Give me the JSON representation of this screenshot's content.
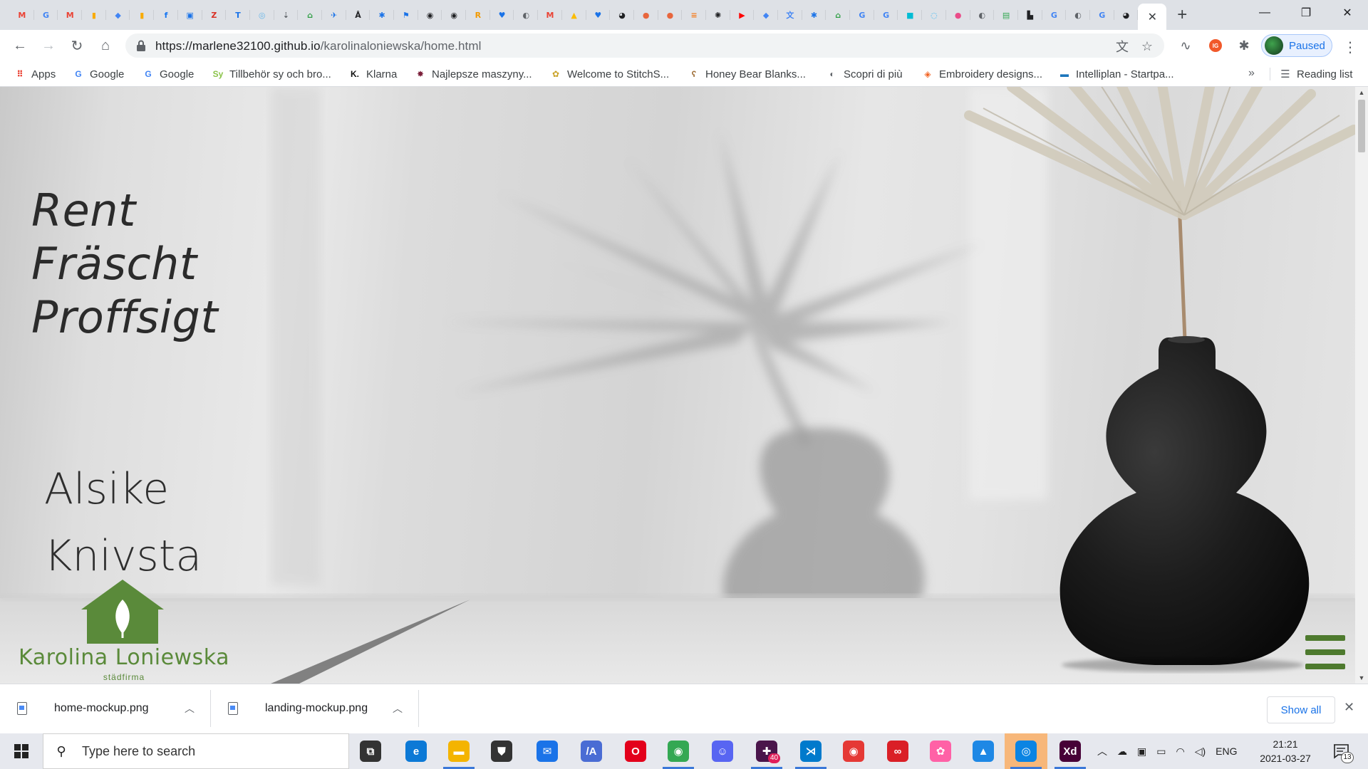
{
  "browser": {
    "tabs": [
      {
        "icon": "gmail-icon",
        "glyph": "M",
        "color": "#ea4335"
      },
      {
        "icon": "google-icon",
        "glyph": "G",
        "color": "#4285f4"
      },
      {
        "icon": "gmail-icon",
        "glyph": "M",
        "color": "#ea4335"
      },
      {
        "icon": "analytics-icon",
        "glyph": "▮",
        "color": "#f9ab00"
      },
      {
        "icon": "diamond-icon",
        "glyph": "◆",
        "color": "#4285f4"
      },
      {
        "icon": "analytics-icon",
        "glyph": "▮",
        "color": "#f9ab00"
      },
      {
        "icon": "facebook-icon",
        "glyph": "f",
        "color": "#1877f2"
      },
      {
        "icon": "box-icon",
        "glyph": "▣",
        "color": "#1a73e8"
      },
      {
        "icon": "zotero-icon",
        "glyph": "Z",
        "color": "#d93025"
      },
      {
        "icon": "teams-icon",
        "glyph": "T",
        "color": "#1a73e8"
      },
      {
        "icon": "spiral-icon",
        "glyph": "◎",
        "color": "#6ab7e8"
      },
      {
        "icon": "download-icon",
        "glyph": "⇣",
        "color": "#5f6368"
      },
      {
        "icon": "house-icon",
        "glyph": "⌂",
        "color": "#2e9e44"
      },
      {
        "icon": "plane-icon",
        "glyph": "✈",
        "color": "#1a73e8"
      },
      {
        "icon": "compass-icon",
        "glyph": "Å",
        "color": "#202124"
      },
      {
        "icon": "puzzle-icon",
        "glyph": "✱",
        "color": "#1a73e8"
      },
      {
        "icon": "flag-icon",
        "glyph": "⚑",
        "color": "#1a73e8"
      },
      {
        "icon": "dark-square-icon",
        "glyph": "◉",
        "color": "#202124"
      },
      {
        "icon": "dark-square-icon",
        "glyph": "◉",
        "color": "#202124"
      },
      {
        "icon": "r-icon",
        "glyph": "R",
        "color": "#f29900"
      },
      {
        "icon": "heart-icon",
        "glyph": "♥",
        "color": "#1a73e8"
      },
      {
        "icon": "globe-icon",
        "glyph": "◐",
        "color": "#5f6368"
      },
      {
        "icon": "gmail-icon",
        "glyph": "M",
        "color": "#ea4335"
      },
      {
        "icon": "drive-icon",
        "glyph": "▲",
        "color": "#fbbc04"
      },
      {
        "icon": "heart-icon",
        "glyph": "♥",
        "color": "#1a73e8"
      },
      {
        "icon": "github-icon",
        "glyph": "◕",
        "color": "#202124"
      },
      {
        "icon": "hedgehog-icon",
        "glyph": "●",
        "color": "#e8663d"
      },
      {
        "icon": "hedgehog-icon",
        "glyph": "●",
        "color": "#e8663d"
      },
      {
        "icon": "stack-icon",
        "glyph": "≡",
        "color": "#f48024"
      },
      {
        "icon": "openai-icon",
        "glyph": "✺",
        "color": "#202124"
      },
      {
        "icon": "youtube-icon",
        "glyph": "▶",
        "color": "#ff0000"
      },
      {
        "icon": "diamond-icon",
        "glyph": "◆",
        "color": "#4285f4"
      },
      {
        "icon": "translate-icon",
        "glyph": "文",
        "color": "#4285f4"
      },
      {
        "icon": "puzzle-icon",
        "glyph": "✱",
        "color": "#1a73e8"
      },
      {
        "icon": "house-icon",
        "glyph": "⌂",
        "color": "#2e9e44"
      },
      {
        "icon": "google-icon",
        "glyph": "G",
        "color": "#4285f4"
      },
      {
        "icon": "google-icon",
        "glyph": "G",
        "color": "#4285f4"
      },
      {
        "icon": "square-icon",
        "glyph": "■",
        "color": "#00bcd4"
      },
      {
        "icon": "circle-icon",
        "glyph": "◌",
        "color": "#29b6f6"
      },
      {
        "icon": "dribbble-icon",
        "glyph": "●",
        "color": "#ea4c89"
      },
      {
        "icon": "globe-icon",
        "glyph": "◐",
        "color": "#5f6368"
      },
      {
        "icon": "sheet-icon",
        "glyph": "▤",
        "color": "#34a853"
      },
      {
        "icon": "figure-icon",
        "glyph": "▙",
        "color": "#202124"
      },
      {
        "icon": "google-icon",
        "glyph": "G",
        "color": "#4285f4"
      },
      {
        "icon": "globe-icon",
        "glyph": "◐",
        "color": "#5f6368"
      },
      {
        "icon": "google-icon",
        "glyph": "G",
        "color": "#4285f4"
      },
      {
        "icon": "github-icon",
        "glyph": "◕",
        "color": "#202124"
      }
    ],
    "active_tab_close": "✕",
    "new_tab": "+",
    "url_host": "https://marlene32100.github.io",
    "url_path": "/karolinaloniewska/home.html",
    "profile_label": "Paused",
    "extension_badge": "IG"
  },
  "bookmarks": [
    {
      "label": "Apps",
      "icon": "apps-grid-icon",
      "glyph": "⠿",
      "color": "#ea4335"
    },
    {
      "label": "Google",
      "icon": "google-icon",
      "glyph": "G",
      "color": "#4285f4"
    },
    {
      "label": "Google",
      "icon": "google-icon",
      "glyph": "G",
      "color": "#4285f4"
    },
    {
      "label": "Tillbehör sy och bro...",
      "icon": "sy-icon",
      "glyph": "Sy",
      "color": "#8bc34a"
    },
    {
      "label": "Klarna",
      "icon": "klarna-icon",
      "glyph": "K.",
      "color": "#111111"
    },
    {
      "label": "Najlepsze maszyny...",
      "icon": "gear-badge-icon",
      "glyph": "✸",
      "color": "#7b1f3a"
    },
    {
      "label": "Welcome to StitchS...",
      "icon": "stitch-icon",
      "glyph": "✿",
      "color": "#c9a227"
    },
    {
      "label": "Honey Bear Blanks...",
      "icon": "bear-icon",
      "glyph": "ʕ",
      "color": "#a0703a"
    },
    {
      "label": "Scopri di più",
      "icon": "globe-icon",
      "glyph": "◐",
      "color": "#5f6368"
    },
    {
      "label": "Embroidery designs...",
      "icon": "magento-icon",
      "glyph": "◈",
      "color": "#f26322"
    },
    {
      "label": "Intelliplan - Startpa...",
      "icon": "intelliplan-icon",
      "glyph": "▬",
      "color": "#1b75bc"
    }
  ],
  "bookmarks_more": "»",
  "reading_list": "Reading list",
  "page": {
    "slogan": [
      "Rent",
      "Fräscht",
      "Proffsigt"
    ],
    "cities": [
      "Alsike",
      "Knivsta"
    ],
    "logo_name": "Karolina Loniewska",
    "logo_sub": "städfirma",
    "accent_color": "#5a8a3a"
  },
  "downloads": [
    {
      "name": "home-mockup.png"
    },
    {
      "name": "landing-mockup.png"
    }
  ],
  "downloads_show_all": "Show all",
  "taskbar": {
    "search_placeholder": "Type here to search",
    "apps": [
      {
        "icon": "task-view-icon",
        "glyph": "⧉",
        "color": "#333333",
        "run": false
      },
      {
        "icon": "edge-icon",
        "glyph": "e",
        "color": "#0c79d6",
        "run": false
      },
      {
        "icon": "file-explorer-icon",
        "glyph": "▬",
        "color": "#f4b400",
        "run": true
      },
      {
        "icon": "store-icon",
        "glyph": "⛊",
        "color": "#333333",
        "run": false
      },
      {
        "icon": "mail-icon",
        "glyph": "✉",
        "color": "#1a73e8",
        "run": false
      },
      {
        "icon": "editor-icon",
        "glyph": "/A",
        "color": "#4a6cd4",
        "run": false
      },
      {
        "icon": "opera-icon",
        "glyph": "O",
        "color": "#e3001b",
        "run": false
      },
      {
        "icon": "chrome-icon",
        "glyph": "◉",
        "color": "#34a853",
        "run": true
      },
      {
        "icon": "discord-icon",
        "glyph": "☺",
        "color": "#5865f2",
        "run": false
      },
      {
        "icon": "slack-icon",
        "glyph": "✚",
        "color": "#4a154b",
        "run": true
      },
      {
        "icon": "vscode-icon",
        "glyph": "⋊",
        "color": "#007acc",
        "run": true
      },
      {
        "icon": "recorder-icon",
        "glyph": "◉",
        "color": "#e53935",
        "run": false
      },
      {
        "icon": "creative-cloud-icon",
        "glyph": "∞",
        "color": "#da1f26",
        "run": false
      },
      {
        "icon": "photo-icon",
        "glyph": "✿",
        "color": "#ff61a6",
        "run": false
      },
      {
        "icon": "photos-icon",
        "glyph": "▲",
        "color": "#1e88e5",
        "run": false
      },
      {
        "icon": "snip-icon",
        "glyph": "◎",
        "color": "#0b84e3",
        "run": true,
        "active": true
      },
      {
        "icon": "xd-icon",
        "glyph": "Xd",
        "color": "#470137",
        "run": true
      }
    ],
    "slack_badge": "40",
    "tray_lang": "ENG",
    "time": "21:21",
    "date": "2021-03-27",
    "notification_count": "13"
  }
}
